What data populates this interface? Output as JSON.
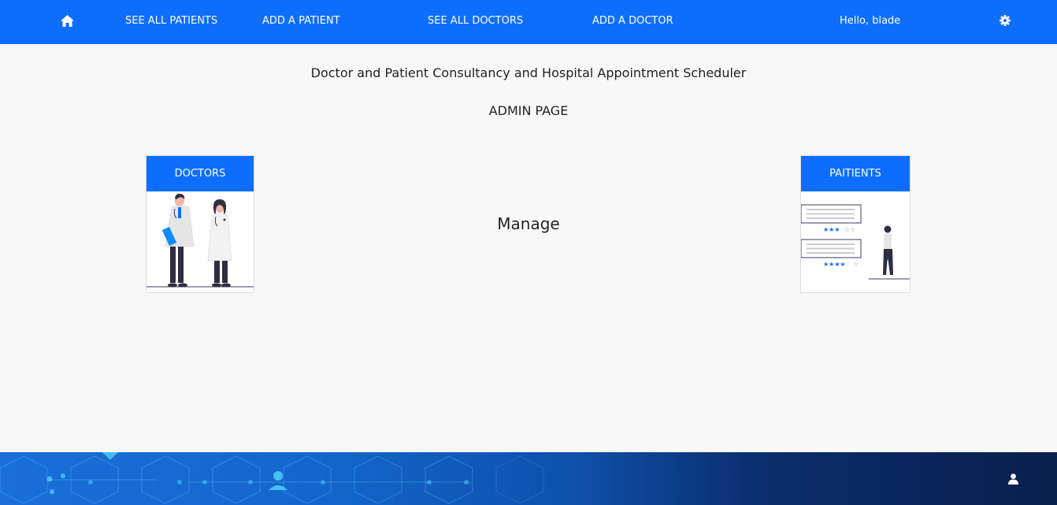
{
  "navbar": {
    "home_icon": "home-icon",
    "links": [
      {
        "label": "SEE ALL PATIENTS"
      },
      {
        "label": "ADD A PATIENT"
      },
      {
        "label": "SEE ALL DOCTORS"
      },
      {
        "label": "ADD A DOCTOR"
      }
    ],
    "greeting": "Hello, blade",
    "settings_icon": "gear-icon",
    "color": "#0d6efd"
  },
  "main": {
    "title": "Doctor and Patient Consultancy and Hospital Appointment Scheduler",
    "subtitle": "ADMIN PAGE",
    "manage_label": "Manage",
    "cards": [
      {
        "label": "DOCTORS",
        "illustration": "doctors-illustration"
      },
      {
        "label": "PAITIENTS",
        "illustration": "patients-review-illustration"
      }
    ]
  },
  "footer": {
    "background": "medical-hexagon-network-banner",
    "user_icon": "user-icon"
  }
}
